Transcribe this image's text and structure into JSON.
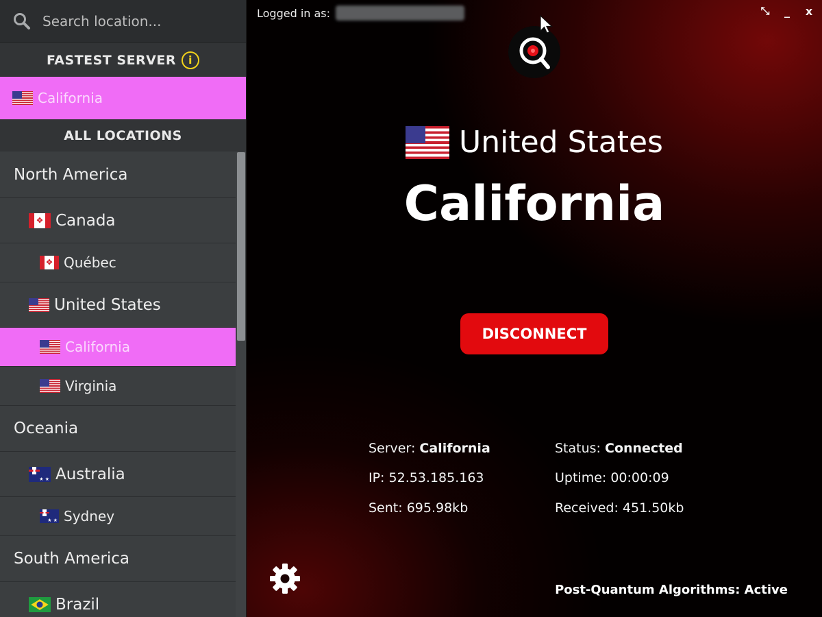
{
  "search": {
    "placeholder": "Search location..."
  },
  "sidebar": {
    "fastest_header": "FASTEST SERVER",
    "fastest_info_glyph": "i",
    "fastest_item": {
      "label": "California",
      "flag": "us-flag-icon"
    },
    "all_locations_header": "ALL LOCATIONS",
    "locations": [
      {
        "level": "region",
        "label": "North America"
      },
      {
        "level": "country",
        "label": "Canada",
        "flag": "ca"
      },
      {
        "level": "city",
        "label": "Québec",
        "flag": "ca"
      },
      {
        "level": "country",
        "label": "United States",
        "flag": "us"
      },
      {
        "level": "city",
        "label": "California",
        "flag": "us",
        "selected": true
      },
      {
        "level": "city",
        "label": "Virginia",
        "flag": "us"
      },
      {
        "level": "region",
        "label": "Oceania"
      },
      {
        "level": "country",
        "label": "Australia",
        "flag": "au"
      },
      {
        "level": "city",
        "label": "Sydney",
        "flag": "au"
      },
      {
        "level": "region",
        "label": "South America"
      },
      {
        "level": "country",
        "label": "Brazil",
        "flag": "br"
      }
    ]
  },
  "header": {
    "logged_in_label": "Logged in as:",
    "controls": {
      "restore": "⤡",
      "minimize": "_",
      "close": "x"
    }
  },
  "connection": {
    "country": "United States",
    "city": "California",
    "disconnect_label": "DISCONNECT"
  },
  "stats": {
    "server_label": "Server:",
    "server_value": "California",
    "ip_label": "IP:",
    "ip_value": "52.53.185.163",
    "sent_label": "Sent:",
    "sent_value": "695.98kb",
    "status_label": "Status:",
    "status_value": "Connected",
    "uptime_label": "Uptime:",
    "uptime_value": "00:00:09",
    "received_label": "Received:",
    "received_value": "451.50kb"
  },
  "footer": {
    "post_quantum": "Post-Quantum Algorithms: Active"
  },
  "colors": {
    "accent_pink": "#f06cf6",
    "disconnect_red": "#e20a0e",
    "info_yellow": "#f2d21b"
  }
}
